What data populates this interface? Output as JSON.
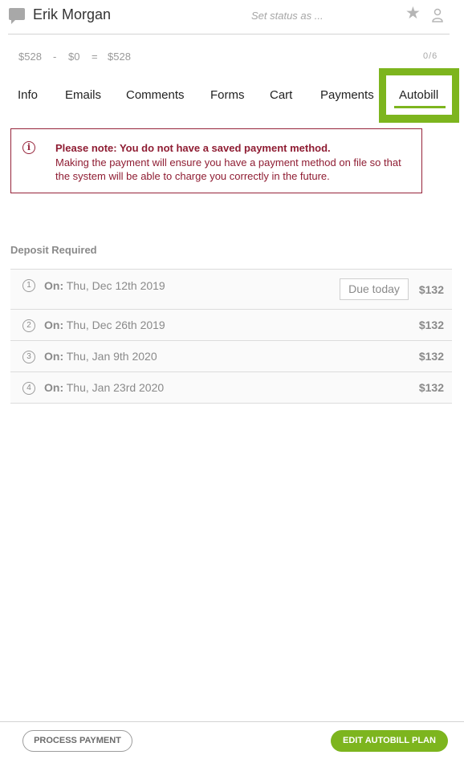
{
  "header": {
    "name": "Erik Morgan",
    "status_placeholder": "Set status as ..."
  },
  "balance": {
    "total": "$528",
    "minus": "-",
    "paid": "$0",
    "equals": "=",
    "due": "$528",
    "count": "0/6"
  },
  "tabs": [
    {
      "label": "Info"
    },
    {
      "label": "Emails"
    },
    {
      "label": "Comments"
    },
    {
      "label": "Forms"
    },
    {
      "label": "Cart"
    },
    {
      "label": "Payments"
    },
    {
      "label": "Autobill",
      "active": true
    }
  ],
  "alert": {
    "icon": "info-icon",
    "title": "Please note: You do not have a saved payment method.",
    "body": "Making the payment will ensure you have a payment method on file so that the system will be able to charge you correctly in the future."
  },
  "deposit": {
    "title": "Deposit Required",
    "on_label": "On:",
    "rows": [
      {
        "number": "1",
        "date": "Thu, Dec 12th 2019",
        "badge": "Due today",
        "amount": "$132"
      },
      {
        "number": "2",
        "date": "Thu, Dec 26th 2019",
        "amount": "$132"
      },
      {
        "number": "3",
        "date": "Thu, Jan 9th 2020",
        "amount": "$132"
      },
      {
        "number": "4",
        "date": "Thu, Jan 23rd 2020",
        "amount": "$132"
      }
    ]
  },
  "footer": {
    "process_label": "PROCESS PAYMENT",
    "edit_label": "EDIT AUTOBILL PLAN"
  },
  "colors": {
    "accent": "#7db51e",
    "alert": "#8f1d33"
  }
}
